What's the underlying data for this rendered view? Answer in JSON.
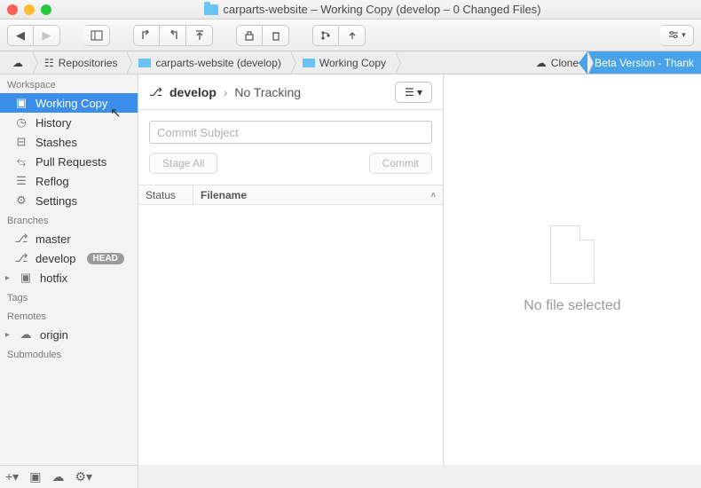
{
  "window": {
    "title": "carparts-website – Working Copy (develop – 0 Changed Files)"
  },
  "pathbar": {
    "repos": "Repositories",
    "repo": "carparts-website (develop)",
    "working": "Working Copy",
    "clone": "Clone",
    "beta": "Beta Version - Thank"
  },
  "sidebar": {
    "sections": {
      "workspace": "Workspace",
      "branches": "Branches",
      "tags": "Tags",
      "remotes": "Remotes",
      "submodules": "Submodules"
    },
    "workspace": {
      "working": "Working Copy",
      "history": "History",
      "stashes": "Stashes",
      "pull": "Pull Requests",
      "reflog": "Reflog",
      "settings": "Settings"
    },
    "branches": {
      "master": "master",
      "develop": "develop",
      "develop_badge": "HEAD",
      "hotfix": "hotfix"
    },
    "remotes": {
      "origin": "origin"
    }
  },
  "mid": {
    "branch": "develop",
    "tracking": "No Tracking",
    "commit_placeholder": "Commit Subject",
    "stage_all": "Stage All",
    "commit": "Commit",
    "th_status": "Status",
    "th_filename": "Filename"
  },
  "right": {
    "empty": "No file selected"
  }
}
